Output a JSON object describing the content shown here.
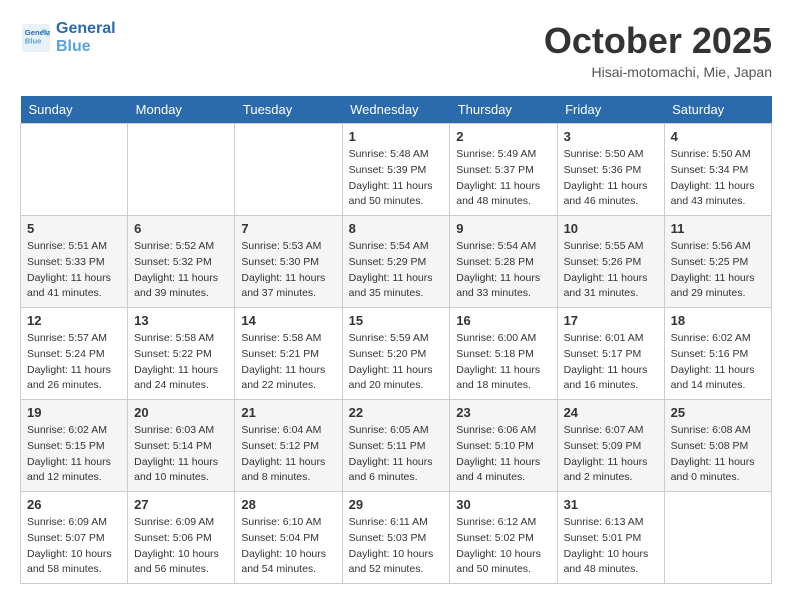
{
  "header": {
    "logo_line1": "General",
    "logo_line2": "Blue",
    "month": "October 2025",
    "location": "Hisai-motomachi, Mie, Japan"
  },
  "weekdays": [
    "Sunday",
    "Monday",
    "Tuesday",
    "Wednesday",
    "Thursday",
    "Friday",
    "Saturday"
  ],
  "weeks": [
    [
      {
        "day": "",
        "info": ""
      },
      {
        "day": "",
        "info": ""
      },
      {
        "day": "",
        "info": ""
      },
      {
        "day": "1",
        "info": "Sunrise: 5:48 AM\nSunset: 5:39 PM\nDaylight: 11 hours\nand 50 minutes."
      },
      {
        "day": "2",
        "info": "Sunrise: 5:49 AM\nSunset: 5:37 PM\nDaylight: 11 hours\nand 48 minutes."
      },
      {
        "day": "3",
        "info": "Sunrise: 5:50 AM\nSunset: 5:36 PM\nDaylight: 11 hours\nand 46 minutes."
      },
      {
        "day": "4",
        "info": "Sunrise: 5:50 AM\nSunset: 5:34 PM\nDaylight: 11 hours\nand 43 minutes."
      }
    ],
    [
      {
        "day": "5",
        "info": "Sunrise: 5:51 AM\nSunset: 5:33 PM\nDaylight: 11 hours\nand 41 minutes."
      },
      {
        "day": "6",
        "info": "Sunrise: 5:52 AM\nSunset: 5:32 PM\nDaylight: 11 hours\nand 39 minutes."
      },
      {
        "day": "7",
        "info": "Sunrise: 5:53 AM\nSunset: 5:30 PM\nDaylight: 11 hours\nand 37 minutes."
      },
      {
        "day": "8",
        "info": "Sunrise: 5:54 AM\nSunset: 5:29 PM\nDaylight: 11 hours\nand 35 minutes."
      },
      {
        "day": "9",
        "info": "Sunrise: 5:54 AM\nSunset: 5:28 PM\nDaylight: 11 hours\nand 33 minutes."
      },
      {
        "day": "10",
        "info": "Sunrise: 5:55 AM\nSunset: 5:26 PM\nDaylight: 11 hours\nand 31 minutes."
      },
      {
        "day": "11",
        "info": "Sunrise: 5:56 AM\nSunset: 5:25 PM\nDaylight: 11 hours\nand 29 minutes."
      }
    ],
    [
      {
        "day": "12",
        "info": "Sunrise: 5:57 AM\nSunset: 5:24 PM\nDaylight: 11 hours\nand 26 minutes."
      },
      {
        "day": "13",
        "info": "Sunrise: 5:58 AM\nSunset: 5:22 PM\nDaylight: 11 hours\nand 24 minutes."
      },
      {
        "day": "14",
        "info": "Sunrise: 5:58 AM\nSunset: 5:21 PM\nDaylight: 11 hours\nand 22 minutes."
      },
      {
        "day": "15",
        "info": "Sunrise: 5:59 AM\nSunset: 5:20 PM\nDaylight: 11 hours\nand 20 minutes."
      },
      {
        "day": "16",
        "info": "Sunrise: 6:00 AM\nSunset: 5:18 PM\nDaylight: 11 hours\nand 18 minutes."
      },
      {
        "day": "17",
        "info": "Sunrise: 6:01 AM\nSunset: 5:17 PM\nDaylight: 11 hours\nand 16 minutes."
      },
      {
        "day": "18",
        "info": "Sunrise: 6:02 AM\nSunset: 5:16 PM\nDaylight: 11 hours\nand 14 minutes."
      }
    ],
    [
      {
        "day": "19",
        "info": "Sunrise: 6:02 AM\nSunset: 5:15 PM\nDaylight: 11 hours\nand 12 minutes."
      },
      {
        "day": "20",
        "info": "Sunrise: 6:03 AM\nSunset: 5:14 PM\nDaylight: 11 hours\nand 10 minutes."
      },
      {
        "day": "21",
        "info": "Sunrise: 6:04 AM\nSunset: 5:12 PM\nDaylight: 11 hours\nand 8 minutes."
      },
      {
        "day": "22",
        "info": "Sunrise: 6:05 AM\nSunset: 5:11 PM\nDaylight: 11 hours\nand 6 minutes."
      },
      {
        "day": "23",
        "info": "Sunrise: 6:06 AM\nSunset: 5:10 PM\nDaylight: 11 hours\nand 4 minutes."
      },
      {
        "day": "24",
        "info": "Sunrise: 6:07 AM\nSunset: 5:09 PM\nDaylight: 11 hours\nand 2 minutes."
      },
      {
        "day": "25",
        "info": "Sunrise: 6:08 AM\nSunset: 5:08 PM\nDaylight: 11 hours\nand 0 minutes."
      }
    ],
    [
      {
        "day": "26",
        "info": "Sunrise: 6:09 AM\nSunset: 5:07 PM\nDaylight: 10 hours\nand 58 minutes."
      },
      {
        "day": "27",
        "info": "Sunrise: 6:09 AM\nSunset: 5:06 PM\nDaylight: 10 hours\nand 56 minutes."
      },
      {
        "day": "28",
        "info": "Sunrise: 6:10 AM\nSunset: 5:04 PM\nDaylight: 10 hours\nand 54 minutes."
      },
      {
        "day": "29",
        "info": "Sunrise: 6:11 AM\nSunset: 5:03 PM\nDaylight: 10 hours\nand 52 minutes."
      },
      {
        "day": "30",
        "info": "Sunrise: 6:12 AM\nSunset: 5:02 PM\nDaylight: 10 hours\nand 50 minutes."
      },
      {
        "day": "31",
        "info": "Sunrise: 6:13 AM\nSunset: 5:01 PM\nDaylight: 10 hours\nand 48 minutes."
      },
      {
        "day": "",
        "info": ""
      }
    ]
  ]
}
